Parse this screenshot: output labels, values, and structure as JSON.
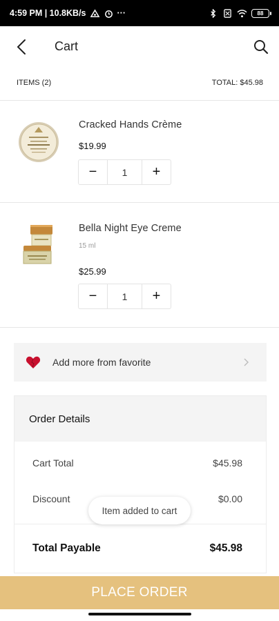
{
  "status_bar": {
    "left_text": "4:59 PM | 10.8KB/s",
    "more": "···",
    "battery": "88"
  },
  "header": {
    "title": "Cart",
    "back_icon": "chevron-left-icon",
    "search_icon": "search-icon"
  },
  "summary": {
    "items_label": "ITEMS (2)",
    "total_label": "TOTAL: $45.98"
  },
  "cart": {
    "items": [
      {
        "name": "Cracked Hands Crème",
        "variant": "",
        "price": "$19.99",
        "quantity": "1",
        "image_icon": "cream-jar-icon"
      },
      {
        "name": "Bella Night Eye Creme",
        "variant": "15 ml",
        "price": "$25.99",
        "quantity": "1",
        "image_icon": "eye-creme-jars-icon"
      }
    ],
    "minus_symbol": "−",
    "plus_symbol": "+"
  },
  "favorite": {
    "label": "Add more from favorite",
    "icon": "heart-icon",
    "accent": "#c8102e"
  },
  "order": {
    "title": "Order Details",
    "cart_total_label": "Cart Total",
    "cart_total_value": "$45.98",
    "discount_label": "Discount",
    "discount_value": "$0.00",
    "payable_label": "Total Payable",
    "payable_value": "$45.98"
  },
  "toast": {
    "text": "Item added to cart"
  },
  "cta": {
    "label": "PLACE ORDER",
    "color": "#e5c17e"
  }
}
